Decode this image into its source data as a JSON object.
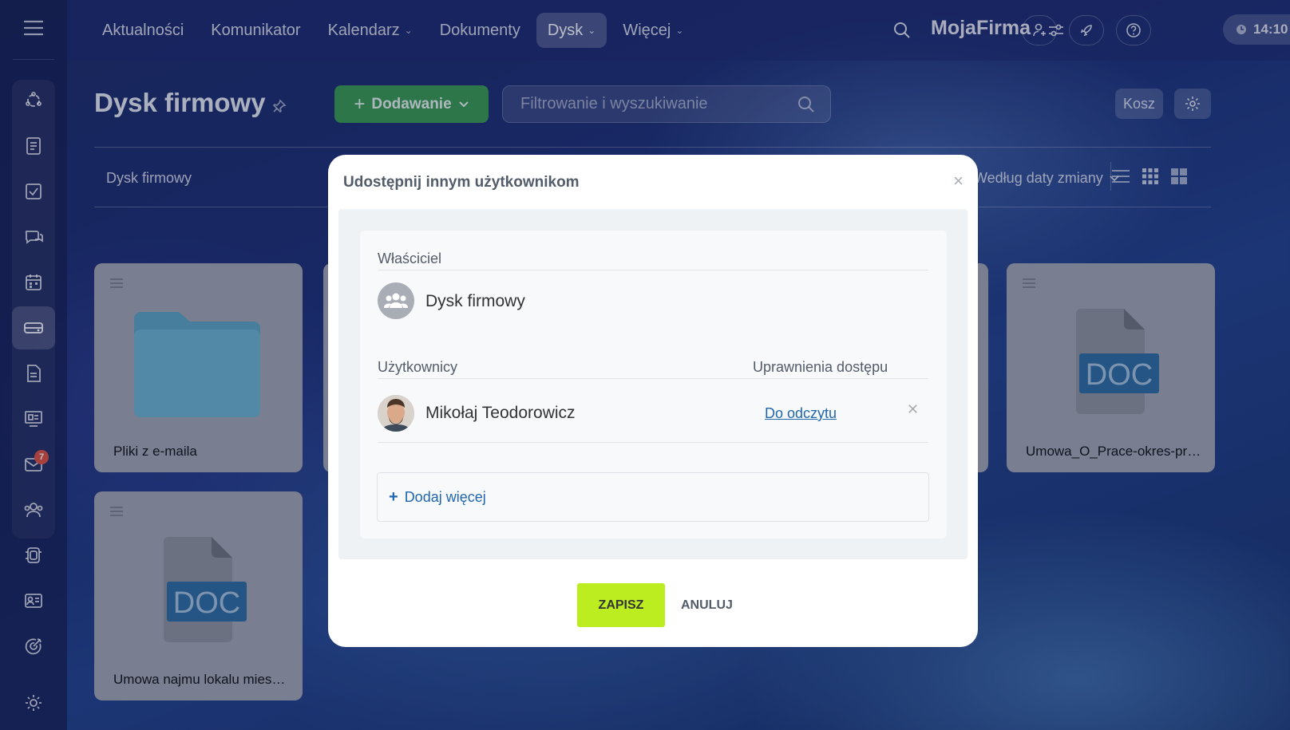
{
  "nav": {
    "items": [
      {
        "label": "Aktualności",
        "dropdown": false,
        "active": false
      },
      {
        "label": "Komunikator",
        "dropdown": false,
        "active": false
      },
      {
        "label": "Kalendarz",
        "dropdown": true,
        "active": false
      },
      {
        "label": "Dokumenty",
        "dropdown": false,
        "active": false
      },
      {
        "label": "Dysk",
        "dropdown": true,
        "active": true
      },
      {
        "label": "Więcej",
        "dropdown": true,
        "active": false
      }
    ],
    "brand": "MojaFirma",
    "time": "14:10"
  },
  "sidebar": {
    "icons": [
      "crm-icon",
      "feed-icon",
      "tasks-icon",
      "chat-icon",
      "calendar-icon",
      "drive-icon",
      "documents-icon",
      "sites-icon",
      "mail-icon",
      "employees-icon",
      "automation-icon",
      "workgroups-icon",
      "targets-icon"
    ],
    "active": "drive-icon",
    "mail_badge": "7",
    "bottom_icon": "settings-icon"
  },
  "page": {
    "title": "Dysk firmowy",
    "add_button": "Dodawanie",
    "search_placeholder": "Filtrowanie i wyszukiwanie",
    "trash_button": "Kosz",
    "breadcrumb": "Dysk firmowy",
    "sort_label": "Według daty zmiany"
  },
  "files": [
    {
      "name": "Pliki z e-maila",
      "type": "folder"
    },
    {
      "name": "Umowa_O_Prace-okres-pro...",
      "type": "doc"
    },
    {
      "name": "Umowa najmu lokalu miesz...",
      "type": "doc"
    }
  ],
  "doc_label": "DOC",
  "colors": {
    "accent_green": "#3a9a4f",
    "save_button": "#bbed21",
    "link": "#2067b0"
  },
  "modal": {
    "title": "Udostępnij innym użytkownikom",
    "owner_label": "Właściciel",
    "owner_name": "Dysk firmowy",
    "users_label": "Użytkownicy",
    "access_label": "Uprawnienia dostępu",
    "users": [
      {
        "name": "Mikołaj Teodorowicz",
        "access": "Do odczytu"
      }
    ],
    "add_more": "Dodaj więcej",
    "save": "ZAPISZ",
    "cancel": "ANULUJ"
  }
}
